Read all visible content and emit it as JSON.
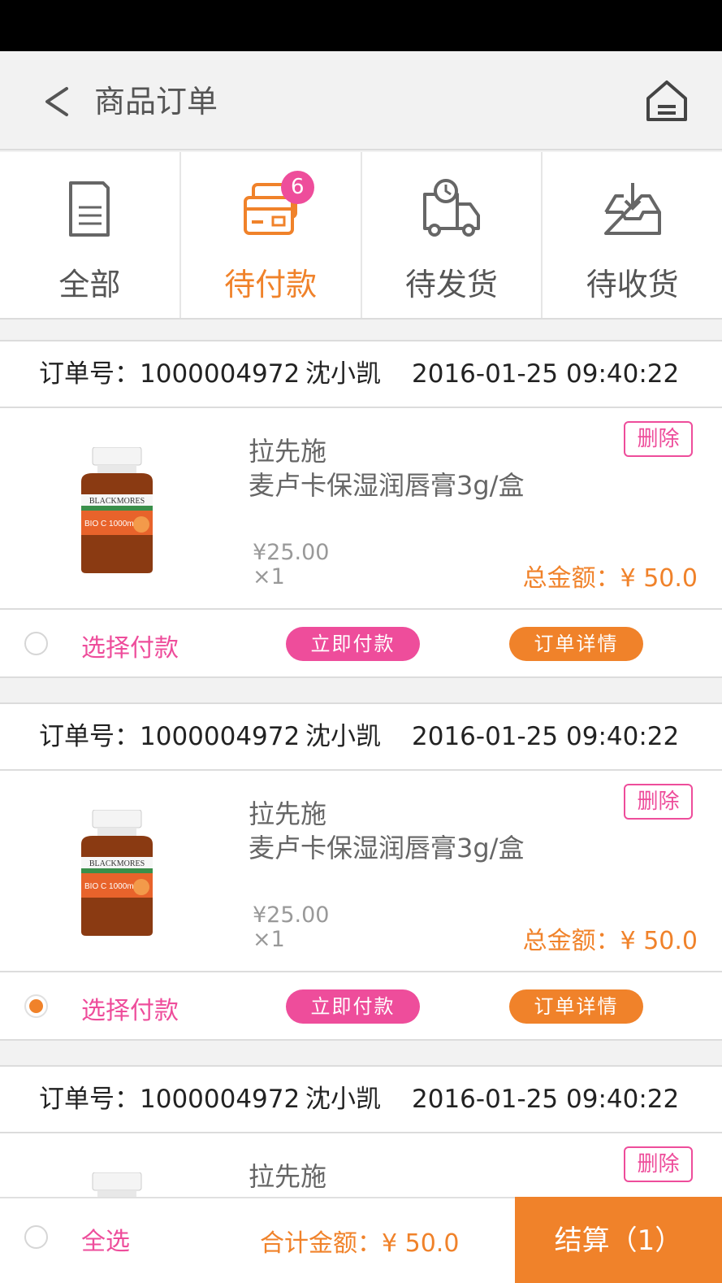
{
  "nav": {
    "title": "商品订单"
  },
  "tabs": [
    {
      "label": "全部",
      "icon": "document-icon"
    },
    {
      "label": "待付款",
      "icon": "card-icon",
      "badge": "6"
    },
    {
      "label": "待发货",
      "icon": "truck-icon"
    },
    {
      "label": "待收货",
      "icon": "inbox-icon"
    }
  ],
  "orders": [
    {
      "order_no": "订单号：1000004972",
      "customer": "沈小凯",
      "time": "2016-01-25 09:40:22",
      "brand": "拉先施",
      "product": "麦卢卡保湿润唇膏3g/盒",
      "price": "¥25.00",
      "qty": "×1",
      "total": "总金额：¥ 50.0",
      "delete_label": "删除",
      "select_label": "选择付款",
      "pay_label": "立即付款",
      "detail_label": "订单详情",
      "selected": false
    },
    {
      "order_no": "订单号：1000004972",
      "customer": "沈小凯",
      "time": "2016-01-25 09:40:22",
      "brand": "拉先施",
      "product": "麦卢卡保湿润唇膏3g/盒",
      "price": "¥25.00",
      "qty": "×1",
      "total": "总金额：¥ 50.0",
      "delete_label": "删除",
      "select_label": "选择付款",
      "pay_label": "立即付款",
      "detail_label": "订单详情",
      "selected": true
    },
    {
      "order_no": "订单号：1000004972",
      "customer": "沈小凯",
      "time": "2016-01-25 09:40:22",
      "brand": "拉先施",
      "delete_label": "删除"
    }
  ],
  "product_image_label": "BLACKMORES",
  "product_image_sub": "BIO C 1000mg",
  "bottom": {
    "select_all": "全选",
    "sum": "合计金额：¥ 50.0",
    "checkout": "结算（1）"
  },
  "colors": {
    "accent": "#f0822a",
    "pink": "#ee4d9b"
  }
}
